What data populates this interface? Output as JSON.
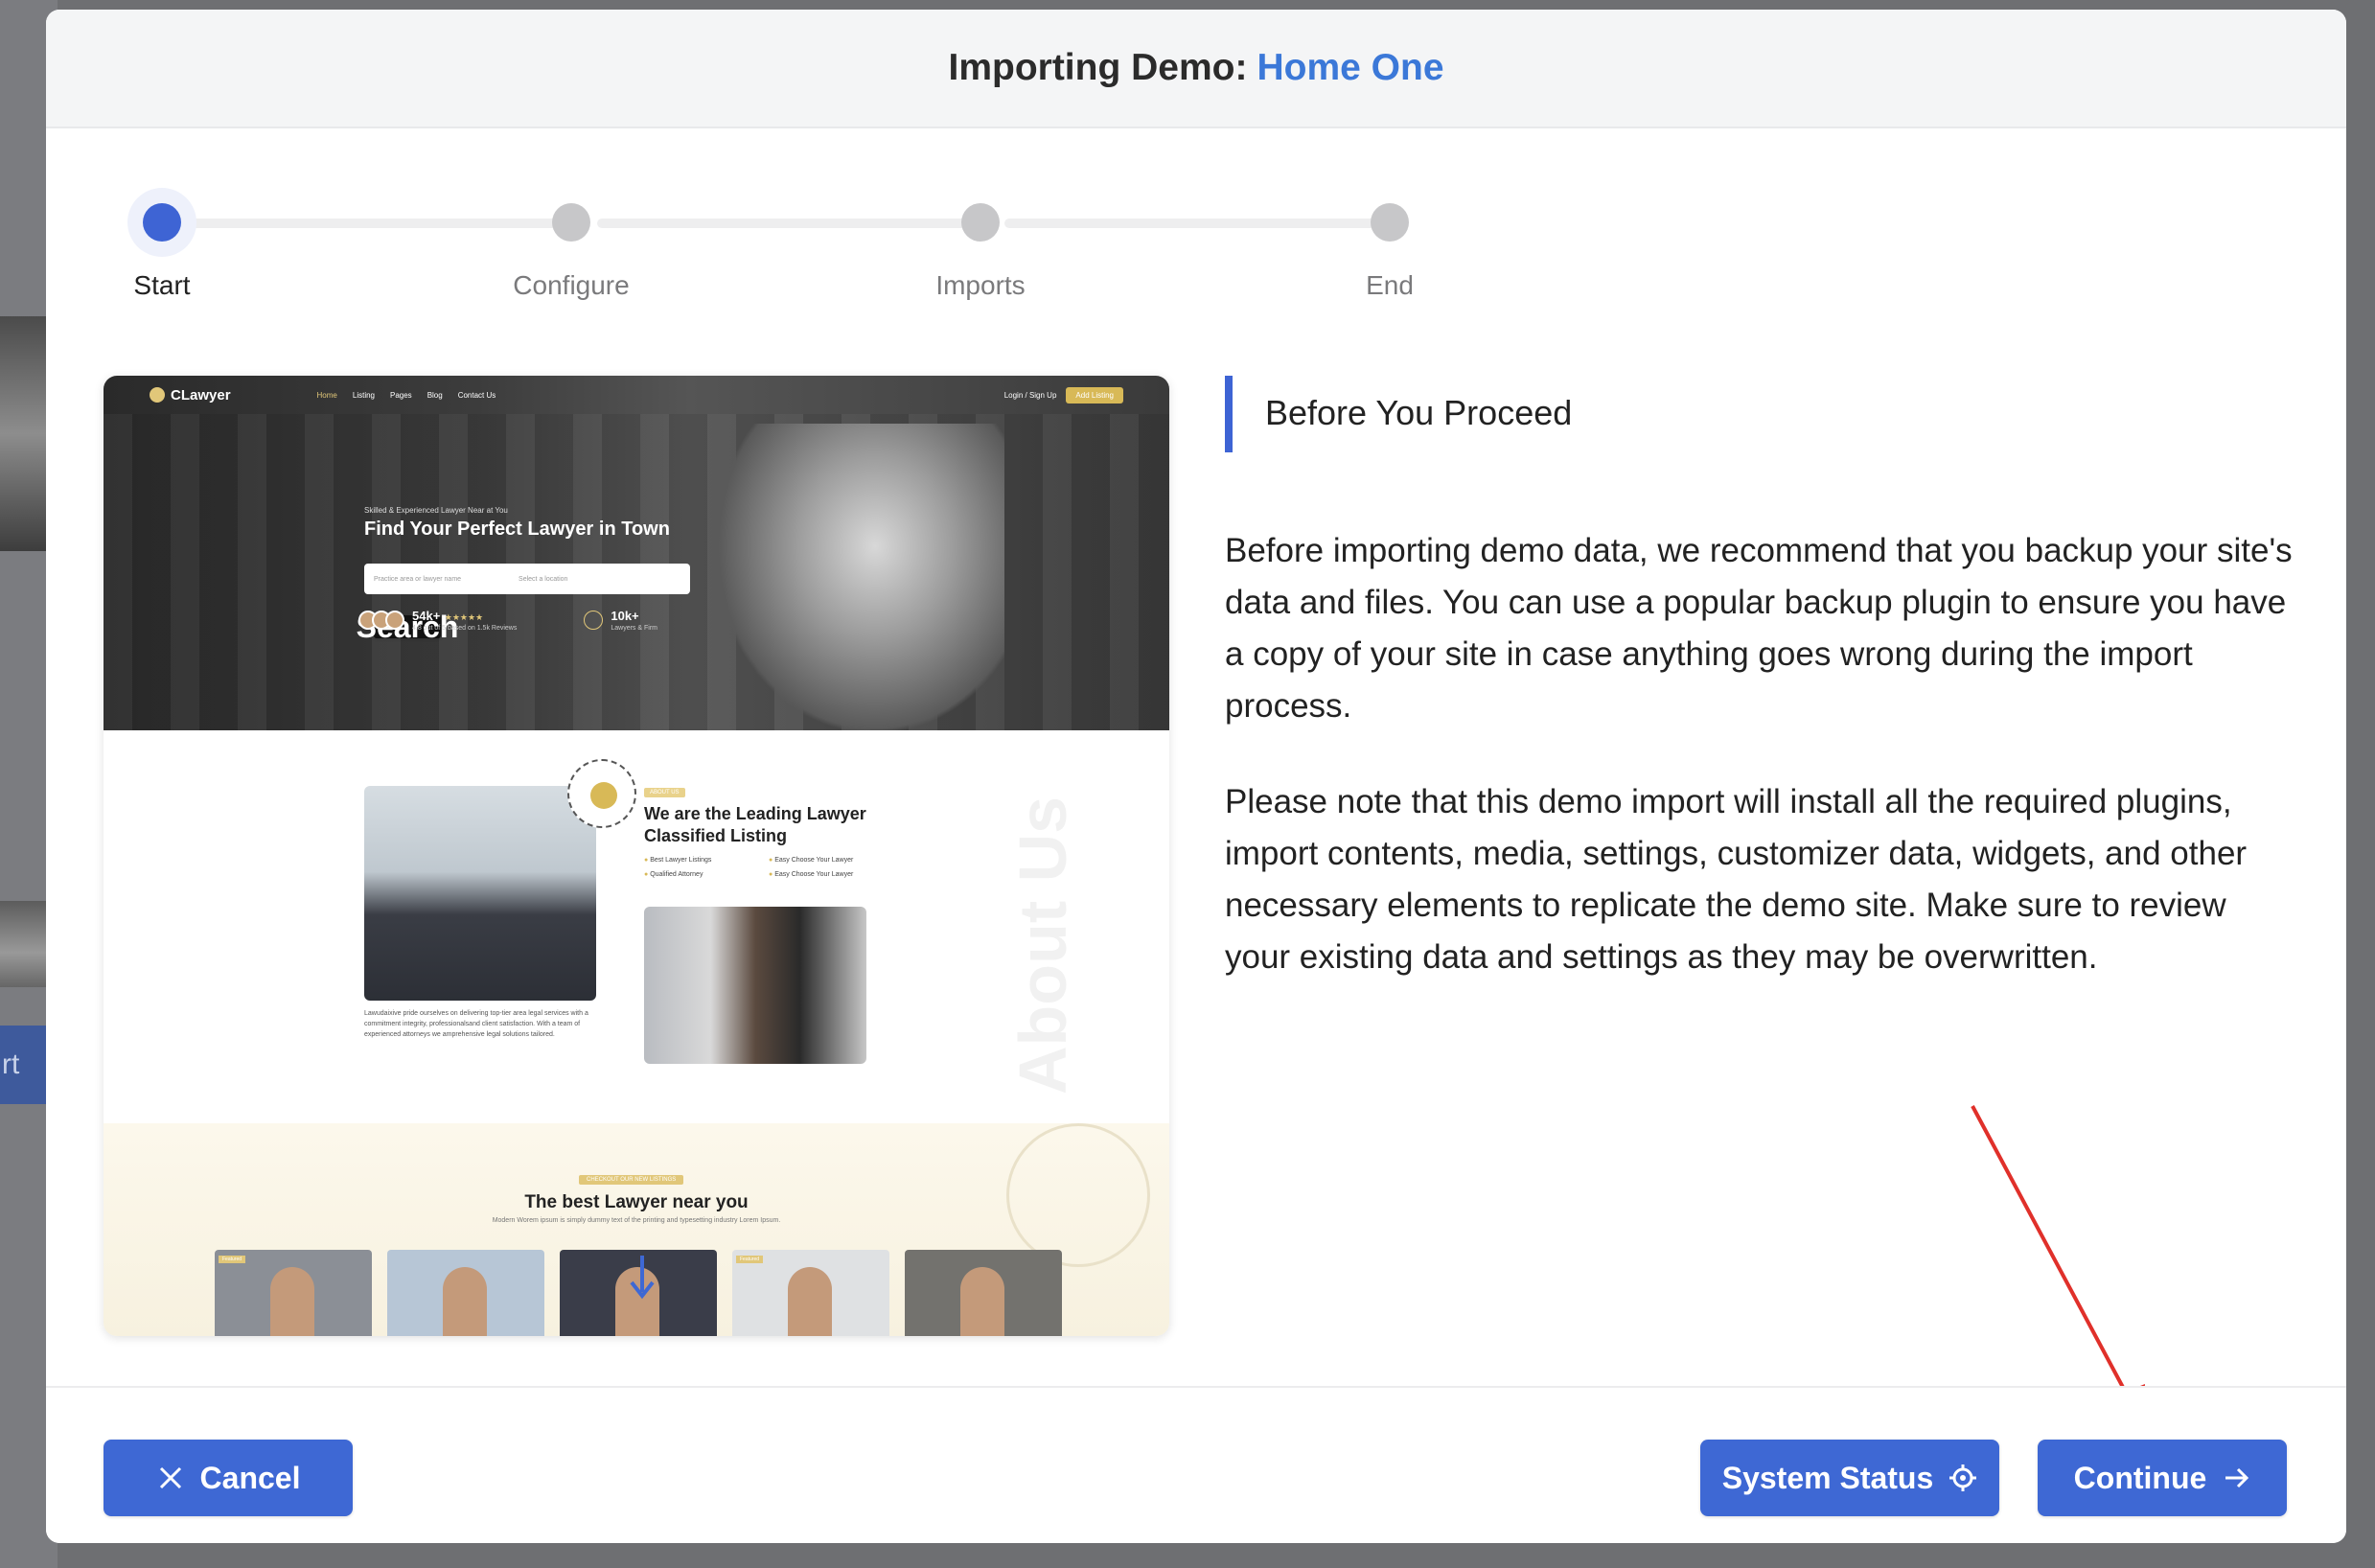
{
  "modal": {
    "title_prefix": "Importing Demo:",
    "demo_name": "Home One"
  },
  "stepper": {
    "steps": [
      {
        "label": "Start",
        "active": true
      },
      {
        "label": "Configure",
        "active": false
      },
      {
        "label": "Imports",
        "active": false
      },
      {
        "label": "End",
        "active": false
      }
    ]
  },
  "preview": {
    "logo": "CLawyer",
    "menu": [
      "Home",
      "Listing",
      "Pages",
      "Blog",
      "Contact Us"
    ],
    "login": "Login / Sign Up",
    "add_listing": "Add Listing",
    "hero_kicker": "Skilled & Experienced Lawyer Near at You",
    "hero_title": "Find Your Perfect Lawyer in Town",
    "search_placeholder": "Practice area or lawyer name",
    "location_placeholder": "Select a location",
    "search_button": "Search",
    "stat1_value": "54k+",
    "stat1_sub": "4.8 out of 5 based on 1.5k Reviews",
    "stat2_value": "10k+",
    "stat2_sub": "Lawyers & Firm",
    "about_tag": "ABOUT US",
    "about_title": "We are the Leading Lawyer Classified Listing",
    "about_list": [
      "Best Lawyer Listings",
      "Easy Choose Your Lawyer",
      "Qualified Attorney",
      "Easy Choose Your Lawyer"
    ],
    "about_body": "Lawudaixive pride ourselves on delivering top-tier area legal services with a commitment integrity, professionalsand client satisfaction. With a team of experienced attorneys we amprehensive legal solutions tailored.",
    "about_watermark": "About Us",
    "best_tag": "CHECKOUT OUR NEW LISTINGS",
    "best_title": "The best Lawyer near you",
    "best_sub": "Modern Worem ipsum is simply dummy text of the printing and typesetting industry Lorem Ipsum.",
    "card_tag": "Featured"
  },
  "notice": {
    "title": "Before You Proceed",
    "paragraph1": "Before importing demo data, we recommend that you backup your site's data and files. You can use a popular backup plugin to ensure you have a copy of your site in case anything goes wrong during the import process.",
    "paragraph2": "Please note that this demo import will install all the required plugins, import contents, media, settings, customizer data, widgets, and other necessary elements to replicate the demo site. Make sure to review your existing data and settings as they may be overwritten."
  },
  "footer": {
    "cancel_label": "Cancel",
    "system_status_label": "System Status",
    "continue_label": "Continue"
  },
  "background": {
    "partial_tab_text": "rt"
  },
  "colors": {
    "accent": "#3e68d4",
    "demo_name": "#3b78d8",
    "annotation_arrow": "#e0302a"
  }
}
